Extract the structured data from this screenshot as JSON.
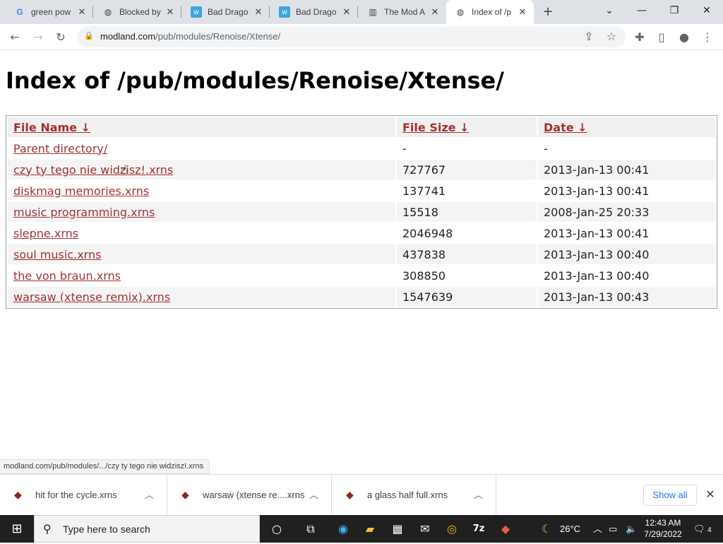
{
  "browser": {
    "tabs": [
      {
        "title": "green pow",
        "icon": "google-icon"
      },
      {
        "title": "Blocked by",
        "icon": "globe-icon"
      },
      {
        "title": "Bad Drago",
        "icon": "w-icon"
      },
      {
        "title": "Bad Drago",
        "icon": "w-icon"
      },
      {
        "title": "The Mod A",
        "icon": "chart-icon"
      },
      {
        "title": "Index of /p",
        "icon": "globe-icon"
      }
    ],
    "url_host": "modland.com",
    "url_path": "/pub/modules/Renoise/Xtense/"
  },
  "page": {
    "title": "Index of /pub/modules/Renoise/Xtense/",
    "headers": {
      "name": "File Name",
      "size": "File Size",
      "date": "Date",
      "sort_arrow": "↓"
    },
    "rows": [
      {
        "name": "Parent directory/",
        "size": "-",
        "date": "-"
      },
      {
        "name": "czy ty tego nie widzisz!.xrns",
        "size": "727767",
        "date": "2013-Jan-13 00:41"
      },
      {
        "name": "diskmag memories.xrns",
        "size": "137741",
        "date": "2013-Jan-13 00:41"
      },
      {
        "name": "music programming.xrns",
        "size": "15518",
        "date": "2008-Jan-25 20:33"
      },
      {
        "name": "slepne.xrns",
        "size": "2046948",
        "date": "2013-Jan-13 00:41"
      },
      {
        "name": "soul music.xrns",
        "size": "437838",
        "date": "2013-Jan-13 00:40"
      },
      {
        "name": "the von braun.xrns",
        "size": "308850",
        "date": "2013-Jan-13 00:40"
      },
      {
        "name": "warsaw (xtense remix).xrns",
        "size": "1547639",
        "date": "2013-Jan-13 00:43"
      }
    ]
  },
  "status_url": "modland.com/pub/modules/.../czy ty tego nie widzisz!.xrns",
  "downloads": {
    "items": [
      "hit for the cycle.xrns",
      "warsaw (xtense re....xrns",
      "a glass half full.xrns"
    ],
    "show_all": "Show all"
  },
  "taskbar": {
    "search_placeholder": "Type here to search",
    "temperature": "26°C",
    "time": "12:43 AM",
    "date": "7/29/2022",
    "notification_count": "4"
  }
}
